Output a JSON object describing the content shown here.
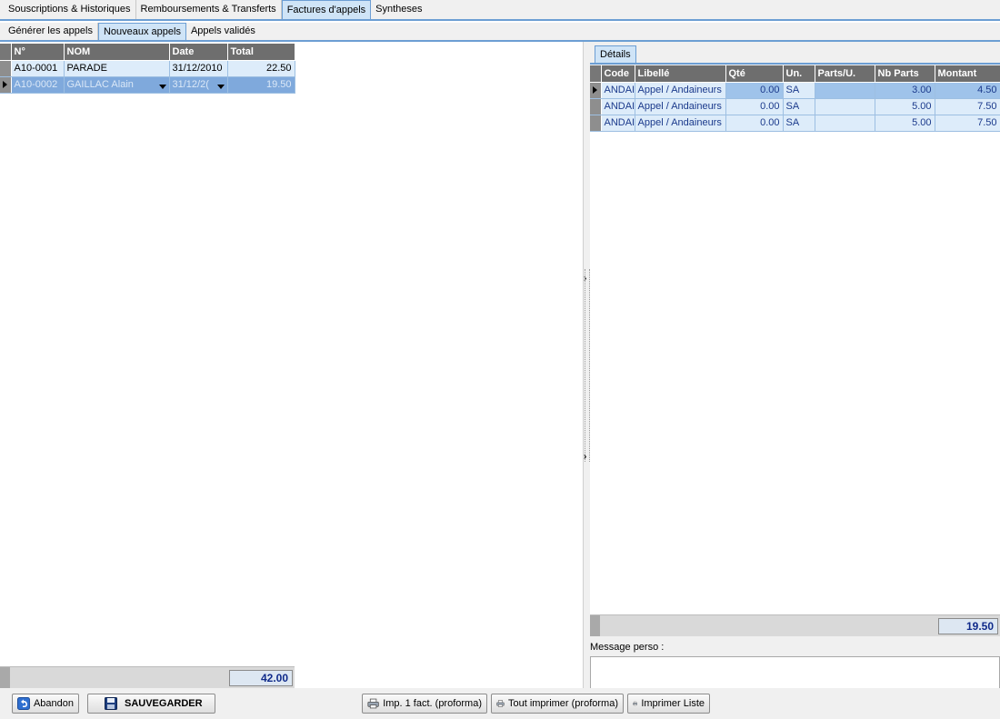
{
  "main_tabs": [
    {
      "label": "Souscriptions & Historiques",
      "active": false
    },
    {
      "label": "Remboursements & Transferts",
      "active": false
    },
    {
      "label": "Factures d'appels",
      "active": true
    },
    {
      "label": "Syntheses",
      "active": false
    }
  ],
  "sub_tabs": [
    {
      "label": "Générer les appels",
      "active": false
    },
    {
      "label": "Nouveaux appels",
      "active": true
    },
    {
      "label": "Appels validés",
      "active": false
    }
  ],
  "appels_grid": {
    "columns": [
      "N°",
      "NOM",
      "Date",
      "Total"
    ],
    "rows": [
      {
        "num": "A10-0001",
        "nom": "PARADE",
        "date": "31/12/2010",
        "total": "22.50"
      },
      {
        "num": "A10-0002",
        "nom": "GAILLAC Alain",
        "date": "31/12/2(",
        "total": "19.50"
      }
    ],
    "total": "42.00"
  },
  "details": {
    "tab_label": "Détails",
    "columns": [
      "Code",
      "Libellé",
      "Qté",
      "Un.",
      "Parts/U.",
      "Nb Parts",
      "Montant"
    ],
    "rows": [
      {
        "code": "ANDAI",
        "libelle": "Appel / Andaineurs",
        "qte": "0.00",
        "un": "SA",
        "parts_u": "",
        "nb_parts": "3.00",
        "montant": "4.50"
      },
      {
        "code": "ANDAI",
        "libelle": "Appel / Andaineurs",
        "qte": "0.00",
        "un": "SA",
        "parts_u": "",
        "nb_parts": "5.00",
        "montant": "7.50"
      },
      {
        "code": "ANDAI",
        "libelle": "Appel / Andaineurs",
        "qte": "0.00",
        "un": "SA",
        "parts_u": "",
        "nb_parts": "5.00",
        "montant": "7.50"
      }
    ],
    "total": "19.50",
    "message_label": "Message perso :",
    "message_value": ""
  },
  "toolbar": {
    "abandon": "Abandon",
    "save": "SAUVEGARDER",
    "print_one": "Imp. 1 fact. (proforma)",
    "print_all": "Tout imprimer (proforma)",
    "print_list": "Imprimer Liste"
  },
  "colors": {
    "accent": "#6c9ed3",
    "header_bg": "#6e6e6e",
    "selected_row": "#7fa9dc",
    "total_text": "#0f2a8a"
  }
}
